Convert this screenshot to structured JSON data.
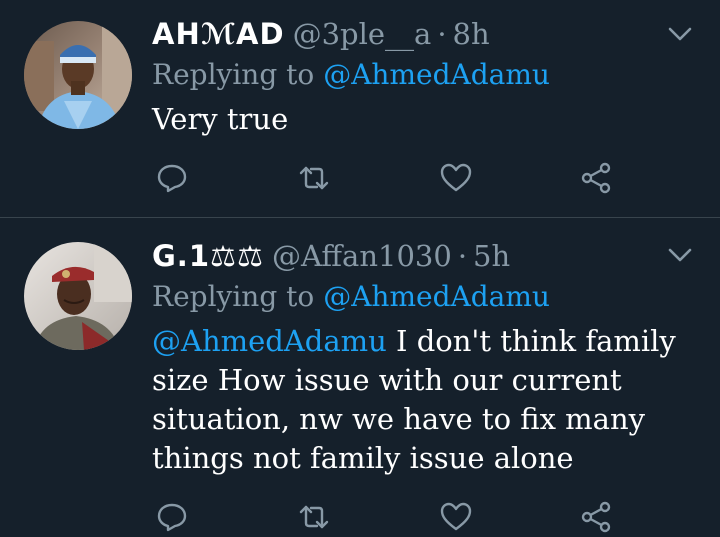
{
  "tweets": [
    {
      "name": "AHℳAD",
      "handle": "@3ple__a",
      "separator": "·",
      "time": "8h",
      "replying_prefix": "Replying to",
      "replying_to": "@AhmedAdamu",
      "body_mention": "",
      "body": "Very true"
    },
    {
      "name": "G.1⚖⚖",
      "handle": "@Affan1030",
      "separator": "·",
      "time": "5h",
      "replying_prefix": "Replying to",
      "replying_to": "@AhmedAdamu",
      "body_mention": "@AhmedAdamu",
      "body": "I don't think family size How issue with our current situation, nw we have to fix many things not family issue alone"
    }
  ],
  "icons": {
    "reply": "reply-icon",
    "retweet": "retweet-icon",
    "like": "heart-icon",
    "share": "share-icon",
    "menu": "chevron-down-icon"
  },
  "colors": {
    "background": "#15202b",
    "accent": "#1da1f2",
    "secondary_text": "#8899a6",
    "divider": "#38444d"
  }
}
